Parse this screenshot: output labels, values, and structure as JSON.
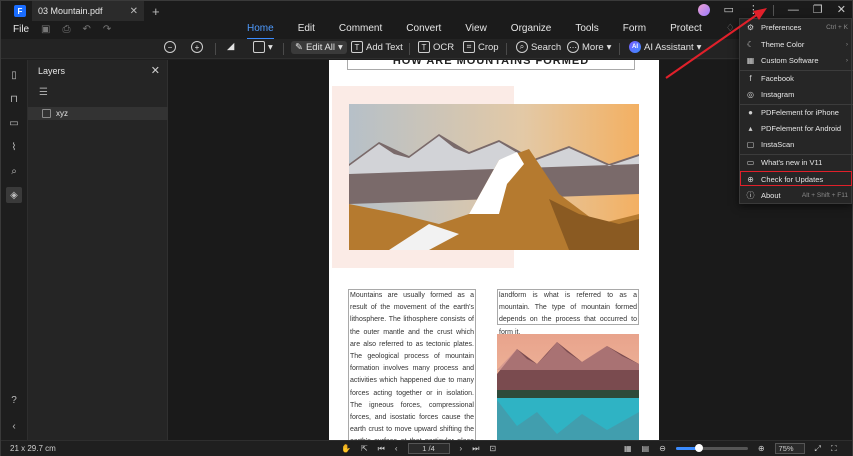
{
  "titlebar": {
    "doc_tab": "03 Mountain.pdf",
    "close_glyph": "✕",
    "new_tab_glyph": "+"
  },
  "menu": {
    "file": "File",
    "tabs": [
      "Home",
      "Edit",
      "Comment",
      "Convert",
      "View",
      "Organize",
      "Tools",
      "Form",
      "Protect"
    ],
    "active_tab": "Home"
  },
  "toolbar": {
    "edit_all": "Edit All",
    "add_text": "Add Text",
    "ocr": "OCR",
    "crop": "Crop",
    "search": "Search",
    "more": "More",
    "ai_assistant": "AI Assistant",
    "ai_badge": "AI"
  },
  "layers": {
    "title": "Layers",
    "items": [
      {
        "name": "xyz"
      }
    ]
  },
  "page": {
    "heading": "HOW ARE MOUNTAINS FORMED",
    "left_text": "Mountains are usually formed as a result of the movement of the earth's lithosphere. The lithosphere consists of the outer mantle and the crust which are also referred to as tectonic plates. The geological process of mountain formation involves many process and activities which happened due to many forces acting together or in isolation. The igneous forces, compressional forces, and isostatic forces cause the earth crust to move upward shifting the earth's surface at that particular place to be higher than the surface of ... The ... ",
    "right_text": "landform is what is referred to as a mountain. The type of mountain formed depends on the process that occurred to form it."
  },
  "dropdown": {
    "items": [
      {
        "icon": "gear-icon",
        "label": "Preferences",
        "shortcut": "Ctrl + K"
      },
      {
        "icon": "moon-icon",
        "label": "Theme Color",
        "shortcut": "›"
      },
      {
        "icon": "grid-icon",
        "label": "Custom Software",
        "shortcut": "›"
      },
      {
        "icon": "facebook-icon",
        "label": "Facebook",
        "shortcut": ""
      },
      {
        "icon": "instagram-icon",
        "label": "Instagram",
        "shortcut": ""
      },
      {
        "icon": "apple-icon",
        "label": "PDFelement for iPhone",
        "shortcut": ""
      },
      {
        "icon": "android-icon",
        "label": "PDFelement for Android",
        "shortcut": ""
      },
      {
        "icon": "scan-icon",
        "label": "InstaScan",
        "shortcut": ""
      },
      {
        "icon": "whats-new-icon",
        "label": "What's new in V11",
        "shortcut": ""
      },
      {
        "icon": "update-icon",
        "label": "Check for Updates",
        "shortcut": ""
      },
      {
        "icon": "info-icon",
        "label": "About",
        "shortcut": "Alt + Shift + F11"
      }
    ],
    "highlighted": "Check for Updates"
  },
  "statusbar": {
    "dimensions": "21 x 29.7 cm",
    "page": "1 /4",
    "zoom": "75%",
    "zoom_fraction": 0.32
  },
  "colors": {
    "accent": "#3b8cff",
    "highlight": "#e0202a",
    "arrow": "#e0202a"
  }
}
